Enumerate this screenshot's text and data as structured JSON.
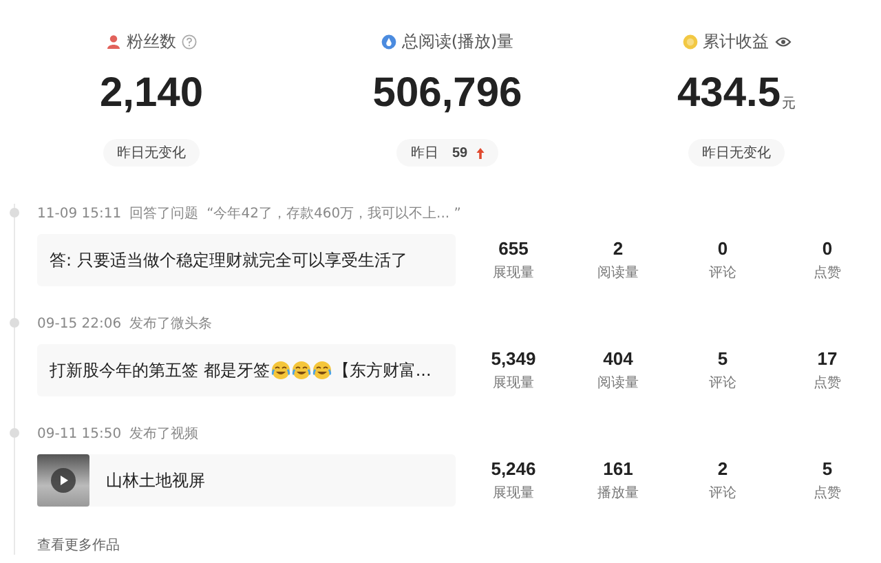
{
  "stats": [
    {
      "kind": "fans",
      "label": "粉丝数",
      "value": "2,140",
      "change": "昨日无变化"
    },
    {
      "kind": "reads",
      "label": "总阅读(播放)量",
      "value": "506,796",
      "change": "昨日",
      "delta": "59"
    },
    {
      "kind": "income",
      "label": "累计收益",
      "value": "434.5",
      "unit": "元",
      "change": "昨日无变化"
    }
  ],
  "timeline": [
    {
      "time": "11-09 15:11",
      "action": "回答了问题",
      "quote": "“今年42了，存款460万，我可以不上... ”",
      "kind": "text",
      "segments": [
        {
          "kind": "text",
          "text": "答: 只要适当做个稳定理财就完全可以享受生活了"
        }
      ],
      "metrics": [
        {
          "value": "655",
          "label": "展现量"
        },
        {
          "value": "2",
          "label": "阅读量"
        },
        {
          "value": "0",
          "label": "评论"
        },
        {
          "value": "0",
          "label": "点赞"
        }
      ]
    },
    {
      "time": "09-15 22:06",
      "action": "发布了微头条",
      "kind": "text",
      "segments": [
        {
          "kind": "text",
          "text": "打新股今年的第五签 都是牙签"
        },
        {
          "kind": "emoji"
        },
        {
          "kind": "emoji"
        },
        {
          "kind": "emoji"
        },
        {
          "kind": "text",
          "text": "【东方财富..."
        }
      ],
      "metrics": [
        {
          "value": "5,349",
          "label": "展现量"
        },
        {
          "value": "404",
          "label": "阅读量"
        },
        {
          "value": "5",
          "label": "评论"
        },
        {
          "value": "17",
          "label": "点赞"
        }
      ]
    },
    {
      "time": "09-11 15:50",
      "action": "发布了视频",
      "kind": "video",
      "segments": [
        {
          "kind": "text",
          "text": "山林土地视屏"
        }
      ],
      "metrics": [
        {
          "value": "5,246",
          "label": "展现量"
        },
        {
          "value": "161",
          "label": "播放量"
        },
        {
          "value": "2",
          "label": "评论"
        },
        {
          "value": "5",
          "label": "点赞"
        }
      ]
    }
  ],
  "more_link": "查看更多作品"
}
